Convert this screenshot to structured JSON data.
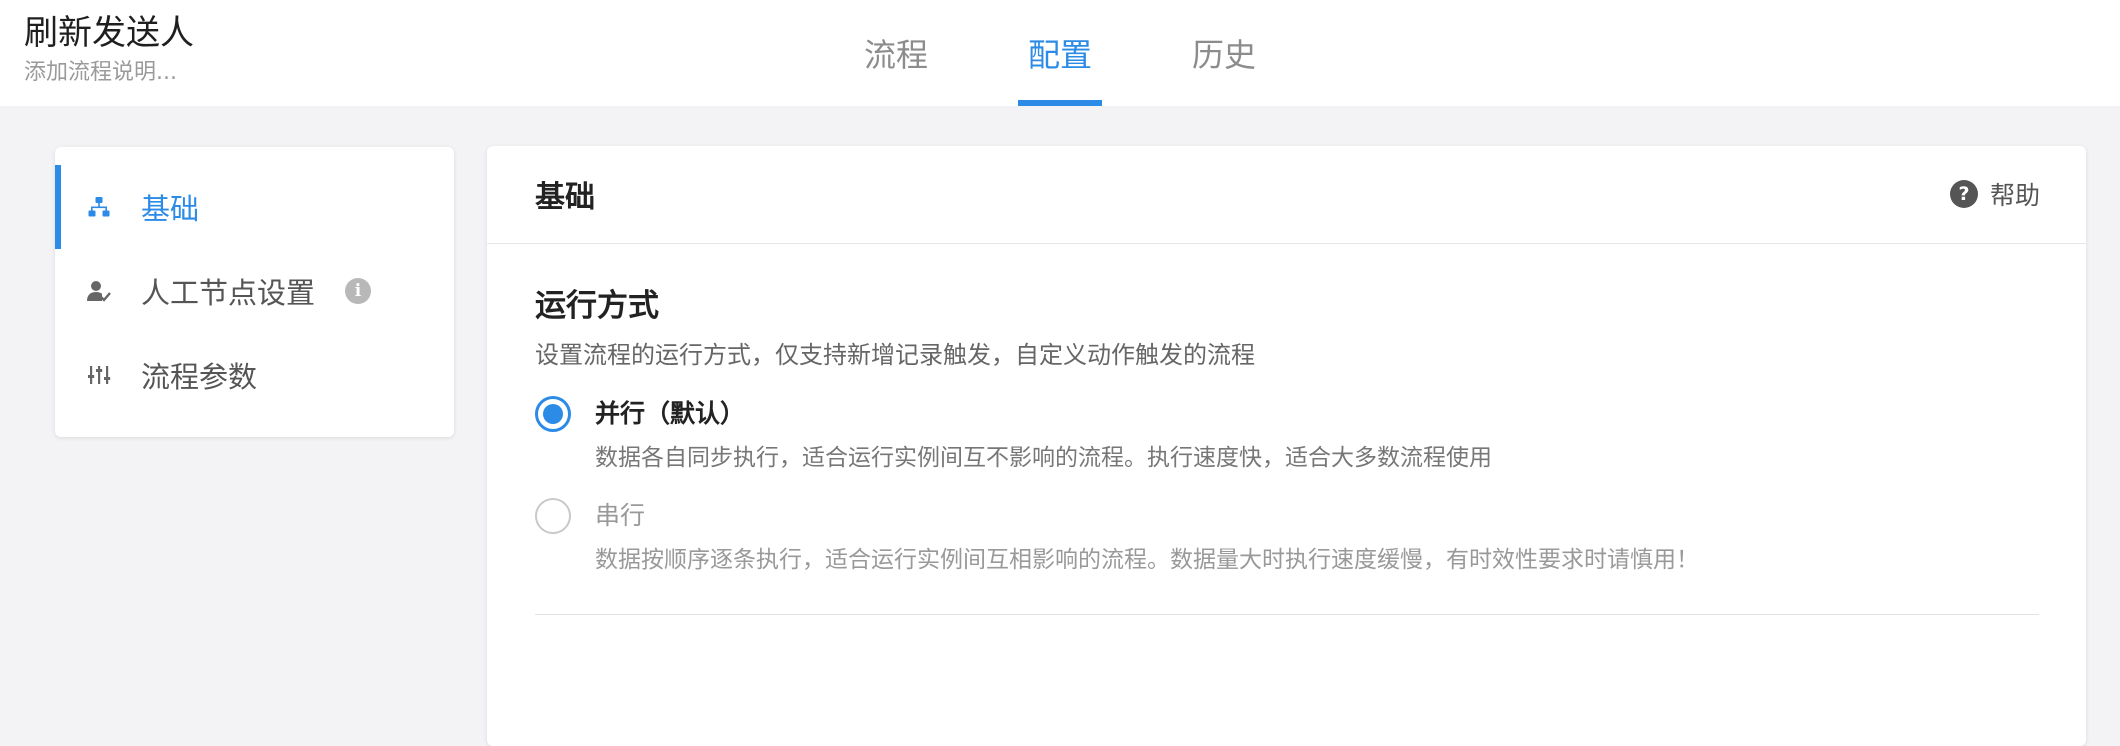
{
  "header": {
    "title": "刷新发送人",
    "description_placeholder": "添加流程说明...",
    "tabs": [
      {
        "label": "流程",
        "active": false
      },
      {
        "label": "配置",
        "active": true
      },
      {
        "label": "历史",
        "active": false
      }
    ]
  },
  "sidebar": {
    "items": [
      {
        "label": "基础",
        "icon": "org-chart-icon",
        "active": true
      },
      {
        "label": "人工节点设置",
        "icon": "user-check-icon",
        "active": false,
        "info_icon": "info-icon"
      },
      {
        "label": "流程参数",
        "icon": "sliders-icon",
        "active": false
      }
    ]
  },
  "main": {
    "title": "基础",
    "help_label": "帮助",
    "help_icon": "question-circle-icon",
    "run_mode": {
      "title": "运行方式",
      "description": "设置流程的运行方式，仅支持新增记录触发，自定义动作触发的流程",
      "options": [
        {
          "label": "并行（默认）",
          "description": "数据各自同步执行，适合运行实例间互不影响的流程。执行速度快，适合大多数流程使用",
          "selected": true
        },
        {
          "label": "串行",
          "description": "数据按顺序逐条执行，适合运行实例间互相影响的流程。数据量大时执行速度缓慢，有时效性要求时请慎用！",
          "selected": false
        }
      ]
    }
  },
  "colors": {
    "accent": "#2b8be6",
    "page_bg": "#f3f3f5",
    "card_bg": "#ffffff"
  }
}
